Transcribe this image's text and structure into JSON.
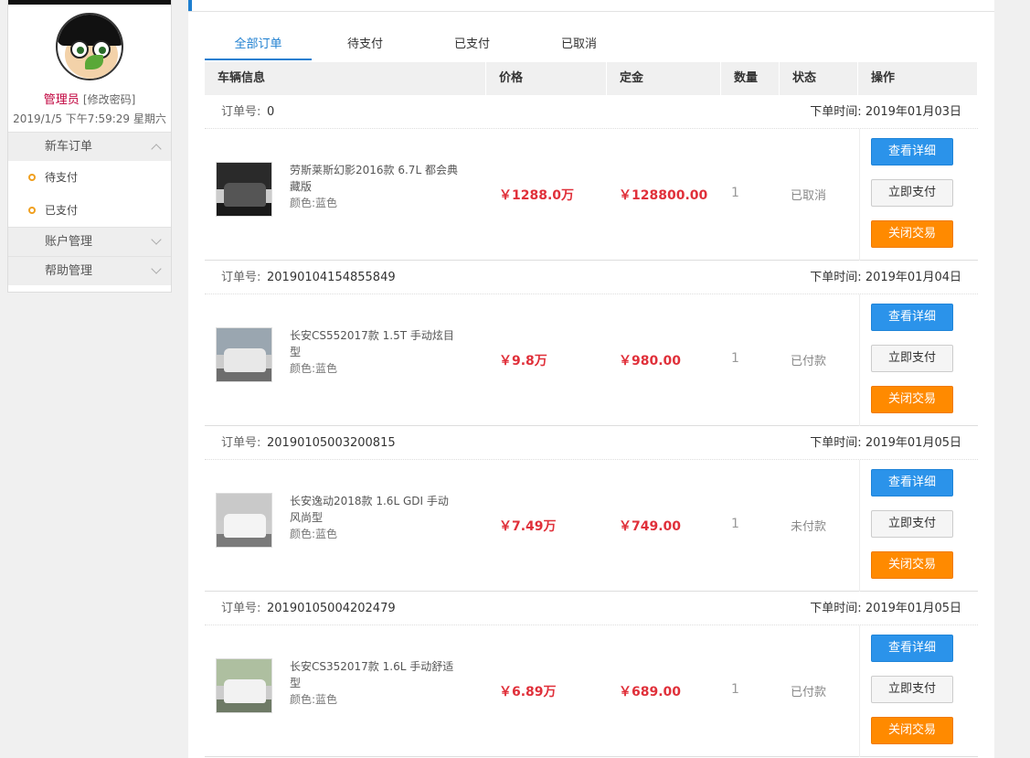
{
  "sidebar": {
    "user_name": "管理员",
    "change_password": "[修改密码]",
    "datetime": "2019/1/5 下午7:59:29 星期六",
    "menu": {
      "new_car_orders": "新车订单",
      "pending_pay": "待支付",
      "paid": "已支付",
      "account_mgmt": "账户管理",
      "help_mgmt": "帮助管理"
    }
  },
  "tabs": [
    "全部订单",
    "待支付",
    "已支付",
    "已取消"
  ],
  "table_headers": {
    "car_info": "车辆信息",
    "price": "价格",
    "deposit": "定金",
    "quantity": "数量",
    "status": "状态",
    "operation": "操作"
  },
  "order_labels": {
    "order_no": "订单号:",
    "order_time": "下单时间:",
    "color_prefix": "颜色:",
    "btn_detail": "查看详细",
    "btn_pay": "立即支付",
    "btn_close": "关闭交易"
  },
  "orders": [
    {
      "order_no": "0",
      "time": "2019年01月03日",
      "car_name": "劳斯莱斯幻影2016款 6.7L 都会典藏版",
      "color": "蓝色",
      "price": "￥1288.0万",
      "deposit": "￥128800.00",
      "quantity": "1",
      "status": "已取消"
    },
    {
      "order_no": "20190104154855849",
      "time": "2019年01月04日",
      "car_name": "长安CS552017款 1.5T 手动炫目型",
      "color": "蓝色",
      "price": "￥9.8万",
      "deposit": "￥980.00",
      "quantity": "1",
      "status": "已付款"
    },
    {
      "order_no": "20190105003200815",
      "time": "2019年01月05日",
      "car_name": "长安逸动2018款 1.6L GDI 手动风尚型",
      "color": "蓝色",
      "price": "￥7.49万",
      "deposit": "￥749.00",
      "quantity": "1",
      "status": "未付款"
    },
    {
      "order_no": "20190105004202479",
      "time": "2019年01月05日",
      "car_name": "长安CS352017款 1.6L 手动舒适型",
      "color": "蓝色",
      "price": "￥6.89万",
      "deposit": "￥689.00",
      "quantity": "1",
      "status": "已付款"
    }
  ],
  "colors": {
    "accent_blue": "#1e7fd0",
    "price_red": "#e0303a",
    "btn_orange": "#ff8a00",
    "user_red": "#c0003c"
  }
}
